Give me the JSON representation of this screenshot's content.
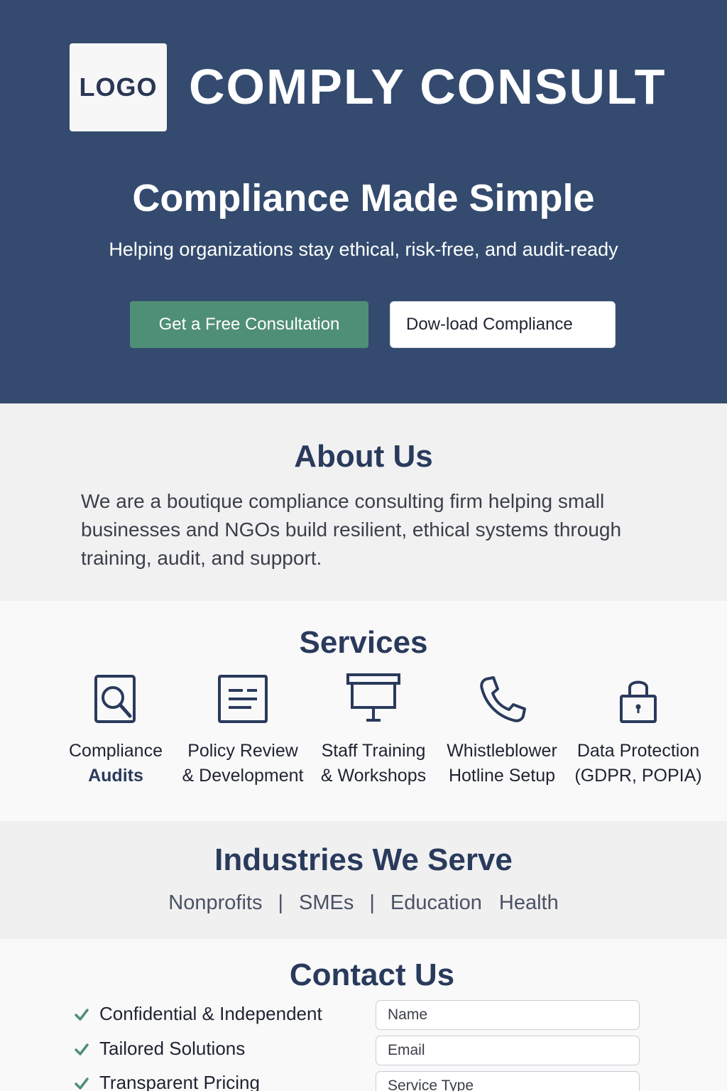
{
  "header": {
    "logo_text": "LOGO",
    "brand_name": "COMPLY CONSULT",
    "title": "Compliance Made Simple",
    "subtitle": "Helping organizations stay ethical, risk-free, and audit-ready",
    "primary_button": "Get a Free Consultation",
    "secondary_button": "Dow-load Compliance"
  },
  "about": {
    "title": "About Us",
    "text": "We are a boutique compliance consulting firm helping small businesses and NGOs build resilient, ethical systems through training, audit, and support."
  },
  "services": {
    "title": "Services",
    "items": [
      {
        "line1": "Compliance",
        "line2": "Audits",
        "icon": "magnifier-document-icon"
      },
      {
        "line1": "Policy Review",
        "line2": "& Development",
        "icon": "document-icon"
      },
      {
        "line1": "Staff Training",
        "line2": "& Workshops",
        "icon": "presentation-board-icon"
      },
      {
        "line1": "Whistleblower",
        "line2": "Hotline Setup",
        "icon": "phone-icon"
      },
      {
        "line1": "Data Protection",
        "line2": "(GDPR, POPIA)",
        "icon": "padlock-icon"
      }
    ]
  },
  "industries": {
    "title": "Industries We Serve",
    "items": [
      "Nonprofits",
      "SMEs",
      "Education",
      "Health"
    ],
    "separator": "|"
  },
  "contact": {
    "title": "Contact Us",
    "bullets": [
      "Confidential & Independent",
      "Tailored Solutions",
      "Transparent Pricing"
    ],
    "form": {
      "name_placeholder": "Name",
      "email_placeholder": "Email",
      "service_placeholder": "Service Type"
    }
  },
  "colors": {
    "hero_bg": "#344b6f",
    "primary_button": "#4f8f75",
    "heading": "#2a3a5c",
    "check": "#4f8f75"
  }
}
